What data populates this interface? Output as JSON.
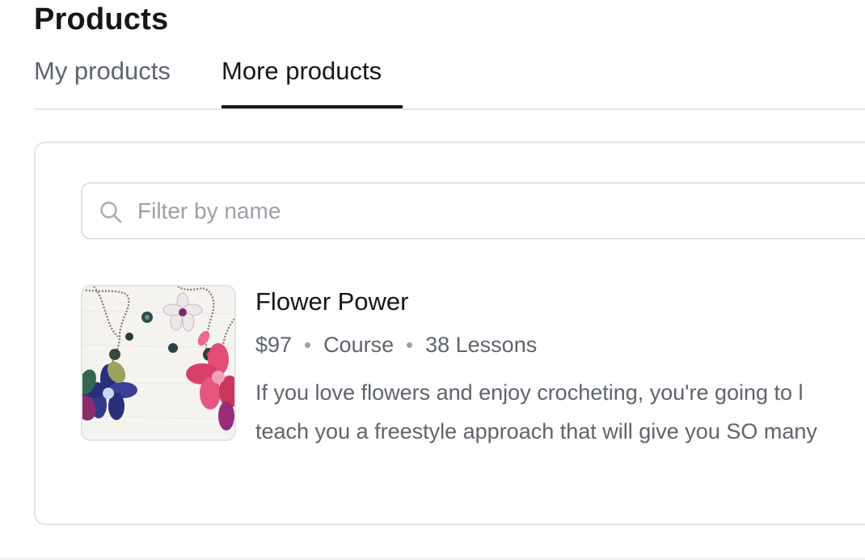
{
  "header": {
    "title": "Products"
  },
  "tabs": [
    {
      "label": "My products",
      "active": false
    },
    {
      "label": "More products",
      "active": true
    }
  ],
  "search": {
    "value": "",
    "placeholder": "Filter by name",
    "icon": "search-icon"
  },
  "products": [
    {
      "title": "Flower Power",
      "price": "$97",
      "type": "Course",
      "lessons": "38 Lessons",
      "description_lines": [
        "If you love flowers and enjoy crocheting, you're going to l",
        "teach you a freestyle approach that will give you SO many"
      ],
      "thumbnail": "crochet-flower-necklaces-image"
    }
  ],
  "colors": {
    "text_primary": "#15171a",
    "text_secondary": "#5f656d",
    "border": "#e3e4e7",
    "active_tab_underline": "#15171a"
  }
}
